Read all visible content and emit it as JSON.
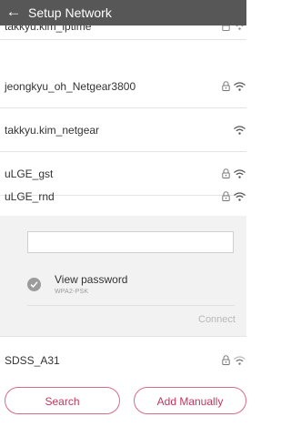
{
  "header": {
    "title": "Setup Network"
  },
  "networks": [
    {
      "ssid": "takkyu.kim_iptime",
      "secured": true
    },
    {
      "ssid": "jeongkyu_oh_Netgear3800",
      "secured": true
    },
    {
      "ssid": "takkyu.kim_netgear",
      "secured": false
    },
    {
      "ssid": "uLGE_gst",
      "secured": true
    },
    {
      "ssid": "uLGE_rnd",
      "secured": true
    },
    {
      "ssid": "SDSS_A31",
      "secured": true
    }
  ],
  "password_panel": {
    "input_value": "",
    "view_password_label": "View password",
    "security_type": "WPA2-PSK",
    "connect_label": "Connect"
  },
  "actions": {
    "search_label": "Search",
    "add_manually_label": "Add Manually"
  },
  "colors": {
    "header_bg": "#575757",
    "accent": "#c2355d",
    "panel_bg": "#f2f2f2"
  }
}
